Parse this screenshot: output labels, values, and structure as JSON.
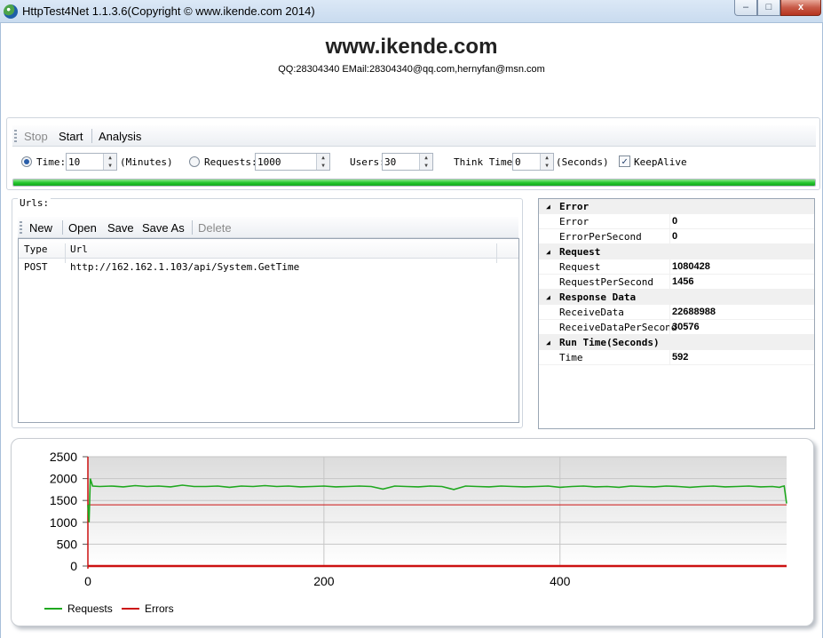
{
  "window": {
    "title": "HttpTest4Net 1.1.3.6(Copyright © www.ikende.com  2014)",
    "minimize_glyph": "–",
    "maximize_glyph": "□",
    "close_glyph": "x"
  },
  "header": {
    "site": "www.ikende.com",
    "contact": "QQ:28304340 EMail:28304340@qq.com,hernyfan@msn.com"
  },
  "toolbar": {
    "stop": "Stop",
    "start": "Start",
    "analysis": "Analysis"
  },
  "options": {
    "time_label": "Time:",
    "time_value": "10",
    "time_unit": "(Minutes)",
    "requests_label": "Requests:",
    "requests_value": "1000",
    "users_label": "Users:",
    "users_value": "30",
    "think_label": "Think Time:",
    "think_value": "0",
    "think_unit": "(Seconds)",
    "keepalive_label": "KeepAlive",
    "keepalive_checked": true,
    "selected_mode": "time",
    "spin_up": "▲",
    "spin_down": "▼",
    "check_glyph": "✓"
  },
  "progress": {
    "fraction": 1.0,
    "color": "#1fc42a"
  },
  "urls": {
    "caption": "Urls:",
    "toolbar": {
      "new": "New",
      "open": "Open",
      "save": "Save",
      "save_as": "Save As",
      "delete": "Delete"
    },
    "columns": {
      "type": "Type",
      "url": "Url"
    },
    "rows": [
      {
        "type": "POST",
        "url": "http://162.162.1.103/api/System.GetTime"
      }
    ]
  },
  "stats": {
    "collapse_glyph": "◢",
    "categories": [
      {
        "name": "Error",
        "rows": [
          {
            "key": "Error",
            "value": "0"
          },
          {
            "key": "ErrorPerSecond",
            "value": "0"
          }
        ]
      },
      {
        "name": "Request",
        "rows": [
          {
            "key": "Request",
            "value": "1080428"
          },
          {
            "key": "RequestPerSecond",
            "value": "1456"
          }
        ]
      },
      {
        "name": "Response Data",
        "rows": [
          {
            "key": "ReceiveData",
            "value": "22688988"
          },
          {
            "key": "ReceiveDataPerSecond",
            "value": "30576"
          }
        ]
      },
      {
        "name": "Run Time(Seconds)",
        "rows": [
          {
            "key": "Time",
            "value": "592"
          }
        ]
      }
    ]
  },
  "chart_data": {
    "type": "line",
    "title": "",
    "xlabel": "",
    "ylabel": "",
    "xlim": [
      0,
      592
    ],
    "ylim": [
      0,
      2500
    ],
    "xticks": [
      0,
      200,
      400
    ],
    "yticks": [
      0,
      500,
      1000,
      1500,
      2000,
      2500
    ],
    "grid": true,
    "legend": "bottom-left",
    "series": [
      {
        "name": "Requests",
        "color": "#1fa81f",
        "x": [
          0,
          1,
          2,
          4,
          10,
          20,
          30,
          40,
          50,
          60,
          70,
          80,
          90,
          100,
          110,
          120,
          130,
          140,
          150,
          160,
          170,
          180,
          190,
          200,
          210,
          220,
          230,
          240,
          250,
          260,
          270,
          280,
          290,
          300,
          310,
          320,
          330,
          340,
          350,
          360,
          370,
          380,
          390,
          400,
          410,
          420,
          430,
          440,
          450,
          460,
          470,
          480,
          490,
          500,
          510,
          520,
          530,
          540,
          550,
          560,
          570,
          580,
          586,
          588,
          590,
          592
        ],
        "values": [
          1400,
          1000,
          2000,
          1830,
          1820,
          1830,
          1810,
          1840,
          1820,
          1830,
          1810,
          1850,
          1820,
          1820,
          1830,
          1800,
          1830,
          1820,
          1840,
          1820,
          1830,
          1810,
          1820,
          1830,
          1810,
          1820,
          1830,
          1820,
          1760,
          1830,
          1820,
          1810,
          1830,
          1820,
          1750,
          1830,
          1820,
          1810,
          1830,
          1820,
          1810,
          1820,
          1830,
          1800,
          1820,
          1830,
          1810,
          1820,
          1800,
          1830,
          1820,
          1810,
          1830,
          1820,
          1800,
          1820,
          1830,
          1810,
          1820,
          1830,
          1810,
          1820,
          1800,
          1820,
          1830,
          1430
        ]
      },
      {
        "name": "Errors",
        "color": "#cc1111",
        "x": [
          0,
          592
        ],
        "values": [
          0,
          0
        ]
      }
    ],
    "threshold": {
      "value": 1400,
      "color": "#cc1111"
    }
  }
}
